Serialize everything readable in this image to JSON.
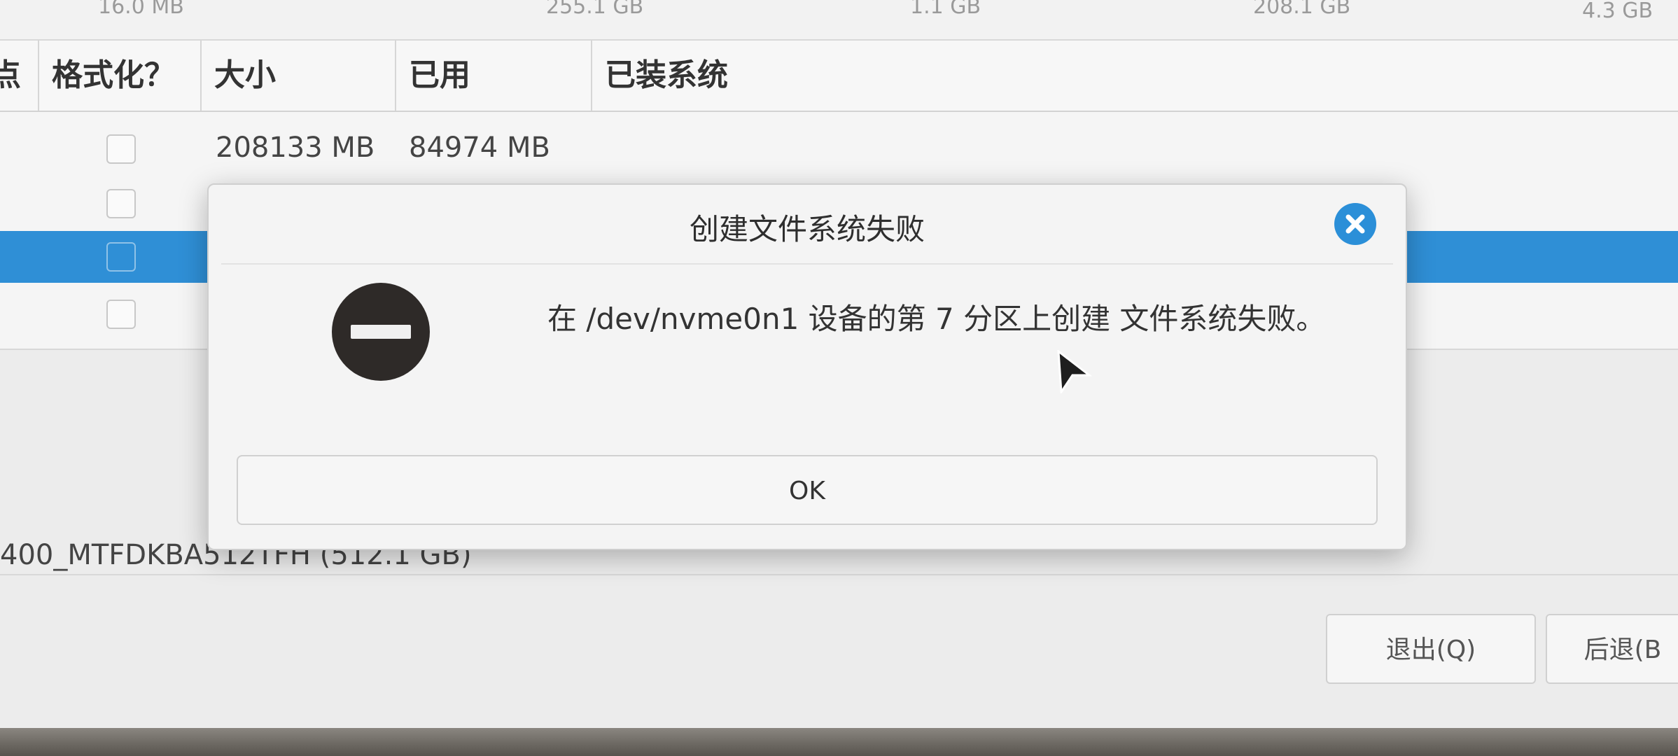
{
  "top_strip": {
    "values": [
      "16.0 MB",
      "255.1 GB",
      "1.1 GB",
      "208.1 GB",
      "4.3 GB"
    ]
  },
  "table": {
    "columns": [
      "点",
      "格式化？",
      "大小",
      "已用",
      "已装系统"
    ],
    "rows": [
      {
        "size": "208133 MB",
        "used": "84974 MB",
        "selected": false
      },
      {
        "size": "",
        "used": "",
        "selected": false
      },
      {
        "size": "",
        "used": "",
        "selected": true
      },
      {
        "size": "",
        "used": "",
        "selected": false
      }
    ]
  },
  "device_label": "400_MTFDKBA512TFH (512.1 GB)",
  "buttons": {
    "quit": "退出(Q)",
    "back": "后退(B"
  },
  "dialog": {
    "title": "创建文件系统失败",
    "message": "在 /dev/nvme0n1 设备的第 7 分区上创建 文件系统失败。",
    "ok": "OK",
    "icon": "stop-icon",
    "close_icon": "close-icon",
    "accent": "#2b8fd8"
  },
  "colors": {
    "selection": "#2f8fd6",
    "background": "#ececec"
  }
}
